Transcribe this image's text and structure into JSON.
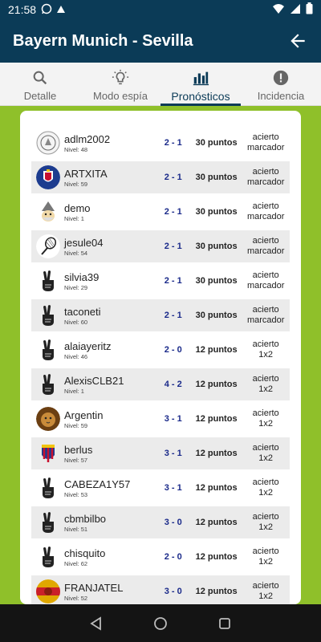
{
  "status": {
    "time": "21:58",
    "battery_icon": "battery-icon",
    "wifi_icon": "wifi-icon"
  },
  "header": {
    "title": "Bayern Munich - Sevilla",
    "back_icon": "arrow-left-icon"
  },
  "tabs": [
    {
      "label": "Detalle",
      "icon": "search-icon"
    },
    {
      "label": "Modo espía",
      "icon": "lightbulb-icon"
    },
    {
      "label": "Pronósticos",
      "icon": "bar-chart-icon",
      "active": true
    },
    {
      "label": "Incidencia",
      "icon": "alert-icon"
    }
  ],
  "level_prefix": "Nivel:",
  "predictions": [
    {
      "user": "adlm2002",
      "level": "48",
      "score": "2 - 1",
      "points": "30 puntos",
      "result_l1": "acierto",
      "result_l2": "marcador",
      "avatar": "crest"
    },
    {
      "user": "ARTXITA",
      "level": "59",
      "score": "2 - 1",
      "points": "30 puntos",
      "result_l1": "acierto",
      "result_l2": "marcador",
      "avatar": "zaragoza"
    },
    {
      "user": "demo",
      "level": "1",
      "score": "2 - 1",
      "points": "30 puntos",
      "result_l1": "acierto",
      "result_l2": "marcador",
      "avatar": "wizard"
    },
    {
      "user": "jesule04",
      "level": "54",
      "score": "2 - 1",
      "points": "30 puntos",
      "result_l1": "acierto",
      "result_l2": "marcador",
      "avatar": "racket"
    },
    {
      "user": "silvia39",
      "level": "29",
      "score": "2 - 1",
      "points": "30 puntos",
      "result_l1": "acierto",
      "result_l2": "marcador",
      "avatar": "fingers"
    },
    {
      "user": "taconeti",
      "level": "60",
      "score": "2 - 1",
      "points": "30 puntos",
      "result_l1": "acierto",
      "result_l2": "marcador",
      "avatar": "fingers"
    },
    {
      "user": "alaiayeritz",
      "level": "46",
      "score": "2 - 0",
      "points": "12 puntos",
      "result_l1": "acierto",
      "result_l2": "1x2",
      "avatar": "fingers"
    },
    {
      "user": "AlexisCLB21",
      "level": "1",
      "score": "4 - 2",
      "points": "12 puntos",
      "result_l1": "acierto",
      "result_l2": "1x2",
      "avatar": "fingers"
    },
    {
      "user": "Argentin",
      "level": "59",
      "score": "3 - 1",
      "points": "12 puntos",
      "result_l1": "acierto",
      "result_l2": "1x2",
      "avatar": "lion"
    },
    {
      "user": "berlus",
      "level": "57",
      "score": "3 - 1",
      "points": "12 puntos",
      "result_l1": "acierto",
      "result_l2": "1x2",
      "avatar": "huesca"
    },
    {
      "user": "CABEZA1Y57",
      "level": "53",
      "score": "3 - 1",
      "points": "12 puntos",
      "result_l1": "acierto",
      "result_l2": "1x2",
      "avatar": "fingers"
    },
    {
      "user": "cbmbilbo",
      "level": "51",
      "score": "3 - 0",
      "points": "12 puntos",
      "result_l1": "acierto",
      "result_l2": "1x2",
      "avatar": "fingers"
    },
    {
      "user": "chisquito",
      "level": "62",
      "score": "2 - 0",
      "points": "12 puntos",
      "result_l1": "acierto",
      "result_l2": "1x2",
      "avatar": "fingers"
    },
    {
      "user": "FRANJATEL",
      "level": "52",
      "score": "3 - 0",
      "points": "12 puntos",
      "result_l1": "acierto",
      "result_l2": "1x2",
      "avatar": "spain"
    }
  ],
  "colors": {
    "header": "#0b3b57",
    "background": "#8fc02a",
    "score": "#1a2a8a",
    "row_alt": "#ebebeb"
  },
  "navbar": {
    "back_icon": "nav-back-icon",
    "home_icon": "nav-home-icon",
    "recents_icon": "nav-recents-icon"
  }
}
